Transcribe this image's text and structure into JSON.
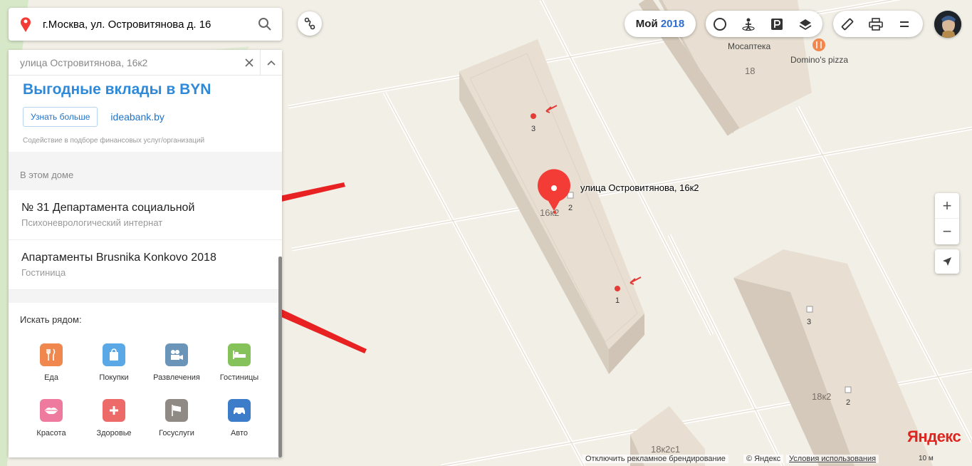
{
  "search": {
    "value": "г.Москва, ул. Островитянова д. 16"
  },
  "panel": {
    "header_address": "улица Островитянова, 16к2",
    "ad": {
      "title": "Выгодные вклады в BYN",
      "button": "Узнать больше",
      "link": "ideabank.by",
      "note": "Содействие в подборе финансовых услуг/организаций"
    },
    "in_building_title": "В этом доме",
    "organizations": [
      {
        "name": "№ 31 Департамента социальной",
        "type": "Психоневрологический интернат"
      },
      {
        "name": "Апартаменты Brusnika Konkovo 2018",
        "type": "Гостиница"
      }
    ],
    "nearby_title": "Искать рядом:",
    "categories": [
      {
        "label": "Еда",
        "icon": "fork-knife-icon",
        "color": "#f0874e"
      },
      {
        "label": "Покупки",
        "icon": "shopping-bag-icon",
        "color": "#5aa9e6"
      },
      {
        "label": "Развлечения",
        "icon": "movie-camera-icon",
        "color": "#6b95b8"
      },
      {
        "label": "Гостиницы",
        "icon": "bed-icon",
        "color": "#85c25a"
      },
      {
        "label": "Красота",
        "icon": "lips-icon",
        "color": "#ef7aa0"
      },
      {
        "label": "Здоровье",
        "icon": "plus-icon",
        "color": "#ec6a68"
      },
      {
        "label": "Госуслуги",
        "icon": "flag-icon",
        "color": "#908a84"
      },
      {
        "label": "Авто",
        "icon": "car-icon",
        "color": "#3d7cc9"
      }
    ]
  },
  "toolbar": {
    "moy_label": "Мой",
    "moy_year": "2018"
  },
  "map": {
    "pin_label": "улица Островитянова, 16к2",
    "labels": {
      "mosapteka": "Мосаптека",
      "dominos": "Domino's pizza",
      "b18": "18",
      "b16k2": "16к2",
      "b18k2": "18к2",
      "b18k2c1": "18к2с1",
      "entr3": "3",
      "entr2": "2",
      "entr1": "1",
      "e3b": "3",
      "e2b": "2"
    }
  },
  "footer": {
    "ads_off": "Отключить рекламное брендирование",
    "copyright": "© Яндекс",
    "terms": "Условия использования",
    "logo": "Яндекс",
    "scale": "10 м"
  }
}
